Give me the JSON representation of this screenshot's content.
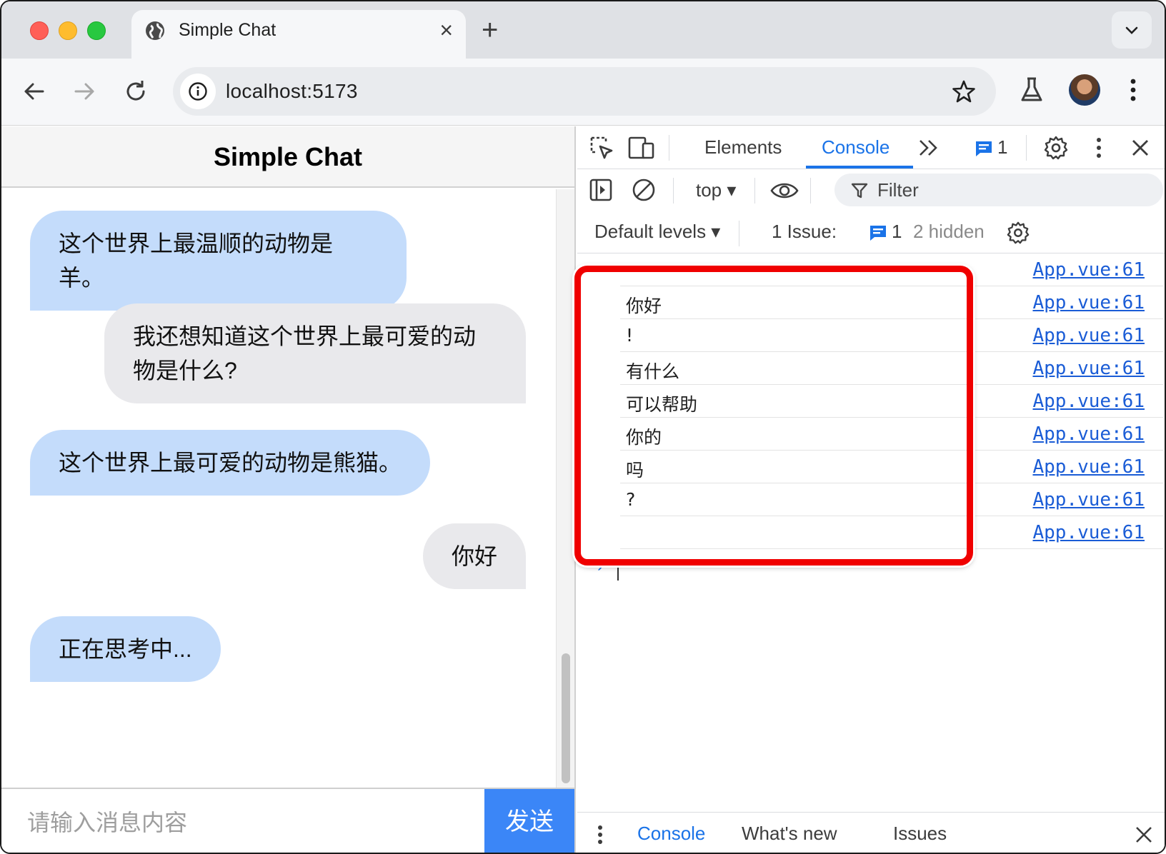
{
  "browser": {
    "tab_title": "Simple Chat",
    "url": "localhost:5173"
  },
  "page": {
    "title": "Simple Chat",
    "messages": [
      {
        "role": "bot",
        "text": "这个世界上最温顺的动物是羊。"
      },
      {
        "role": "user",
        "text": "我还想知道这个世界上最可爱的动物是什么?"
      },
      {
        "role": "bot",
        "text": "这个世界上最可爱的动物是熊猫。"
      },
      {
        "role": "user",
        "text": "你好"
      },
      {
        "role": "bot",
        "text": "正在思考中..."
      }
    ],
    "input_placeholder": "请输入消息内容",
    "send_label": "发送"
  },
  "devtools": {
    "tabs": {
      "elements": "Elements",
      "console": "Console"
    },
    "issues_badge": "1",
    "context": "top",
    "filter_placeholder": "Filter",
    "levels": "Default levels",
    "issue_text": "1 Issue:",
    "issue_count": "1",
    "hidden_text": "2 hidden",
    "source_link": "App.vue:61",
    "log_lines": [
      "",
      "你好",
      "!",
      "有什么",
      "可以帮助",
      "你的",
      "吗",
      "?",
      ""
    ],
    "drawer": {
      "console": "Console",
      "whats_new": "What's new",
      "issues": "Issues"
    }
  },
  "colors": {
    "accent": "#1a73e8",
    "bot_bubble": "#c4dcfb",
    "user_bubble": "#e9e9ec",
    "send_button": "#3b86f7",
    "highlight": "#f00000"
  }
}
